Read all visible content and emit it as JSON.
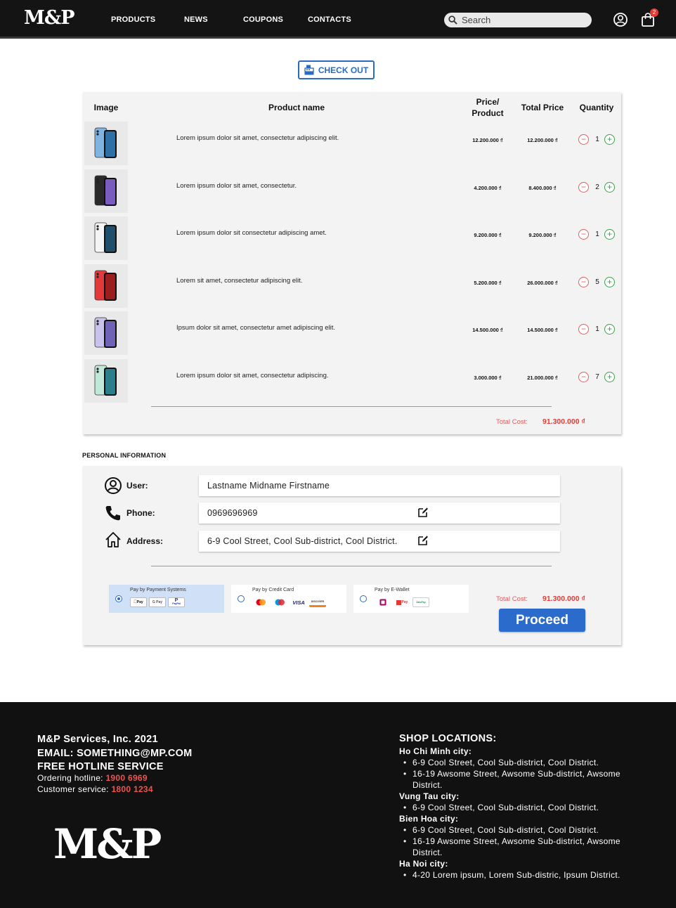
{
  "header": {
    "logo": "M&P",
    "nav": [
      "PRODUCTS",
      "NEWS",
      "COUPONS",
      "CONTACTS"
    ],
    "search_placeholder": "Search",
    "cart_count": "2"
  },
  "checkout": {
    "label": "CHECK OUT"
  },
  "cart": {
    "headers": {
      "image": "Image",
      "name": "Product name",
      "price_l1": "Price/",
      "price_l2": "Product",
      "total": "Total Price",
      "quantity": "Quantity"
    },
    "items": [
      {
        "name": "Lorem ipsum dolor sit amet, consectetur adipiscing elit.",
        "price": "12.200.000 ₫",
        "total": "12.200.000 ₫",
        "qty": "1"
      },
      {
        "name": "Lorem ipsum dolor sit amet, consectetur.",
        "price": "4.200.000 ₫",
        "total": "8.400.000 ₫",
        "qty": "2"
      },
      {
        "name": "Lorem ipsum dolor sit consectetur adipiscing amet.",
        "price": "9.200.000 ₫",
        "total": "9.200.000 ₫",
        "qty": "1"
      },
      {
        "name": "Lorem sit amet, consectetur adipiscing elit.",
        "price": "5.200.000 ₫",
        "total": "26.000.000 ₫",
        "qty": "5"
      },
      {
        "name": "Ipsum dolor sit amet, consectetur amet adipiscing elit.",
        "price": "14.500.000 ₫",
        "total": "14.500.000 ₫",
        "qty": "1"
      },
      {
        "name": "Lorem ipsum dolor sit amet, consectetur adipiscing.",
        "price": "3.000.000 ₫",
        "total": "21.000.000 ₫",
        "qty": "7"
      }
    ],
    "total_label": "Total Cost:",
    "total_value": "91.300.000 ₫",
    "minus": "−",
    "plus": "+"
  },
  "personal": {
    "title": "PERSONAL INFORMATION",
    "user_label": "User:",
    "user_value": "Lastname Midname Firstname",
    "phone_label": "Phone:",
    "phone_value": "0969696969",
    "address_label": "Address:",
    "address_value": "6-9 Cool Street, Cool Sub-district, Cool District."
  },
  "payment": {
    "options": [
      {
        "title": "Pay by Payment Systems",
        "logos": [
          "Pay",
          "G Pay",
          "PayPal"
        ]
      },
      {
        "title": "Pay by Credit Card",
        "logos": [
          "",
          "",
          "VISA",
          "DISCOVER"
        ]
      },
      {
        "title": "Pay by E-Wallet",
        "logos": [
          "",
          "Pay",
          "ZaloPay"
        ]
      }
    ],
    "selected": "Pay by Payment Systems",
    "total_label": "Total Cost:",
    "total_value": "91.300.000 ₫",
    "proceed_label": "Proceed"
  },
  "footer": {
    "company": "M&P Services, Inc. 2021",
    "email": "EMAIL: SOMETHING@MP.COM",
    "hotline_title": "FREE HOTLINE SERVICE",
    "ordering_label": "Ordering hotline: ",
    "ordering_number": "1900 6969",
    "customer_label": "Customer service: ",
    "customer_number": "1800 1234",
    "logo": "M&P",
    "locations_title": "SHOP LOCATIONS:",
    "locations": [
      {
        "city": "Ho Chi Minh city:",
        "addresses": [
          "6-9 Cool Street, Cool Sub-district, Cool District.",
          "16-19 Awsome Street, Awsome Sub-district, Awsome District."
        ]
      },
      {
        "city": "Vung Tau city:",
        "addresses": [
          "6-9 Cool Street, Cool Sub-district, Cool District."
        ]
      },
      {
        "city": "Bien Hoa city:",
        "addresses": [
          "6-9 Cool Street, Cool Sub-district, Cool District.",
          "16-19 Awsome Street, Awsome Sub-district, Awsome District."
        ]
      },
      {
        "city": "Ha Noi city:",
        "addresses": [
          "4-20 Lorem ipsum, Lorem Sub-distric, Ipsum District."
        ]
      }
    ]
  },
  "colors": {
    "accent_blue": "#2a6bcc",
    "total_red": "#e53935",
    "header_bg": "#141414"
  },
  "icons": [
    "search-icon",
    "account-icon",
    "cart-icon",
    "cash-register-icon",
    "user-icon",
    "phone-icon",
    "home-icon",
    "edit-icon",
    "minus-icon",
    "plus-icon"
  ]
}
